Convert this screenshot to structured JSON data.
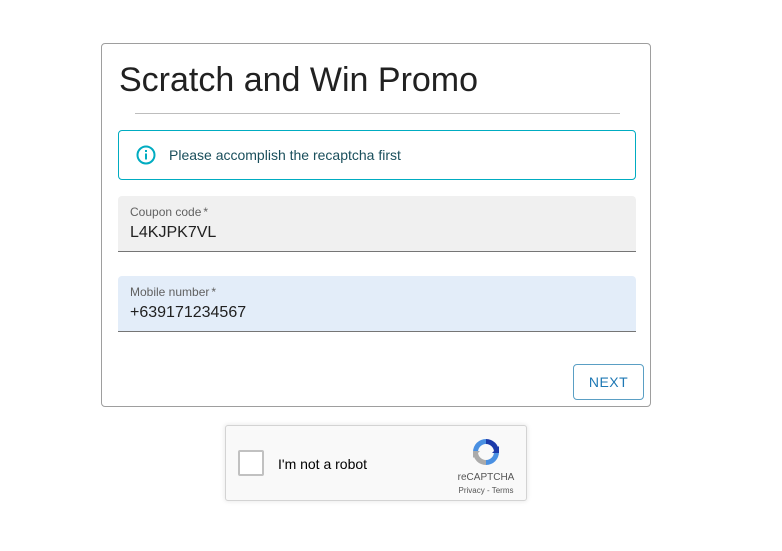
{
  "form": {
    "title": "Scratch and Win Promo",
    "alert": {
      "icon": "info-icon",
      "text": "Please accomplish the recaptcha first",
      "color": "#00acc1"
    },
    "coupon": {
      "label": "Coupon code",
      "required_marker": "*",
      "value": "L4KJPK7VL"
    },
    "mobile": {
      "label": "Mobile number",
      "required_marker": "*",
      "value": "+639171234567"
    },
    "next_label": "NEXT"
  },
  "recaptcha": {
    "label": "I'm not a robot",
    "brand": "reCAPTCHA",
    "privacy": "Privacy",
    "separator": " - ",
    "terms": "Terms",
    "checked": false
  }
}
